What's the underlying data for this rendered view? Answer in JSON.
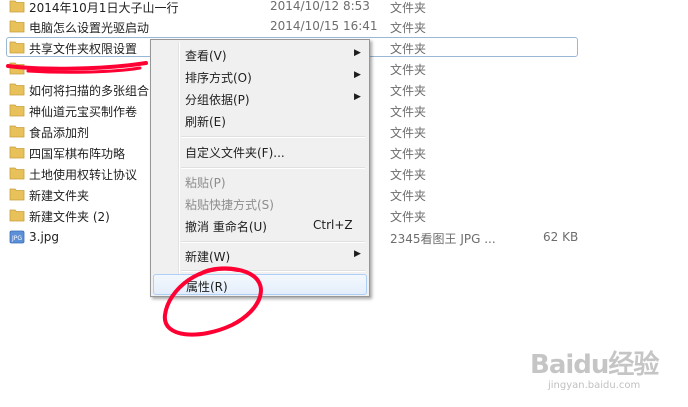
{
  "files": [
    {
      "name": "2014年10月1日大子山一行",
      "date": "2014/10/12 8:53",
      "type": "文件夹",
      "size": "",
      "icon": "folder-icon"
    },
    {
      "name": "电脑怎么设置光驱启动",
      "date": "2014/10/15 16:41",
      "type": "文件夹",
      "size": "",
      "icon": "folder-icon"
    },
    {
      "name": "共享文件夹权限设置",
      "date": "",
      "type": "文件夹",
      "size": "",
      "icon": "folder-icon"
    },
    {
      "name": "",
      "date": "",
      "type": "文件夹",
      "size": "",
      "icon": "folder-icon"
    },
    {
      "name": "如何将扫描的多张组合",
      "date": "",
      "type": "文件夹",
      "size": "",
      "icon": "folder-icon"
    },
    {
      "name": "神仙道元宝买制作卷",
      "date": "",
      "type": "文件夹",
      "size": "",
      "icon": "folder-icon"
    },
    {
      "name": "食品添加剂",
      "date": "",
      "type": "文件夹",
      "size": "",
      "icon": "folder-icon"
    },
    {
      "name": "四国军棋布阵功略",
      "date": "",
      "type": "文件夹",
      "size": "",
      "icon": "folder-icon"
    },
    {
      "name": "土地使用权转让协议",
      "date": "",
      "type": "文件夹",
      "size": "",
      "icon": "folder-icon"
    },
    {
      "name": "新建文件夹",
      "date": "",
      "type": "文件夹",
      "size": "",
      "icon": "folder-icon"
    },
    {
      "name": "新建文件夹 (2)",
      "date": "",
      "type": "文件夹",
      "size": "",
      "icon": "folder-icon"
    },
    {
      "name": "3.jpg",
      "date": "",
      "type": "2345看图王 JPG ...",
      "size": "62 KB",
      "icon": "jpg-file-icon"
    }
  ],
  "context_menu": {
    "items": [
      {
        "label": "查看(V)",
        "submenu": true
      },
      {
        "label": "排序方式(O)",
        "submenu": true
      },
      {
        "label": "分组依据(P)",
        "submenu": true
      },
      {
        "label": "刷新(E)"
      },
      {
        "label": "自定义文件夹(F)..."
      },
      {
        "label": "粘贴(P)",
        "disabled": true
      },
      {
        "label": "粘贴快捷方式(S)",
        "disabled": true
      },
      {
        "label": "撤消 重命名(U)",
        "shortcut": "Ctrl+Z"
      },
      {
        "label": "新建(W)",
        "submenu": true
      },
      {
        "label": "属性(R)",
        "highlighted": true
      }
    ]
  },
  "watermark": {
    "brand": "Baidu经验",
    "url": "jingyan.baidu.com"
  },
  "colors": {
    "folder": "#e8c15a",
    "annotation": "#ff0033",
    "menu_bg": "#f0f0f0"
  }
}
